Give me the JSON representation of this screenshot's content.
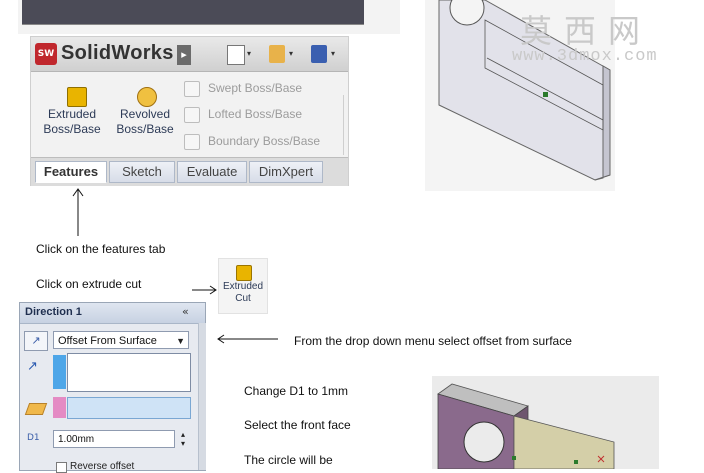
{
  "solidworks": {
    "logo_badge": "SW",
    "brand": "SolidWorks",
    "brand_arrow": "▸",
    "toolbar_caret": "▾",
    "ribbon": {
      "extruded_boss": "Extruded Boss/Base",
      "revolved_boss": "Revolved Boss/Base",
      "swept_boss": "Swept Boss/Base",
      "lofted_boss": "Lofted Boss/Base",
      "boundary_boss": "Boundary Boss/Base"
    },
    "tabs": [
      "Features",
      "Sketch",
      "Evaluate",
      "DimXpert"
    ],
    "active_tab": "Features"
  },
  "watermark": {
    "main": "莫西网",
    "url": "www.3dmox.com"
  },
  "instructions": {
    "features_tab": "Click on the features tab",
    "extrude_cut": "Click on extrude cut",
    "dropdown": "From the drop down menu  select offset from surface",
    "change_d1": "Change D1 to 1mm",
    "select_face": "Select the front face",
    "circle": "The circle will be"
  },
  "extruded_cut": {
    "label": "Extruded Cut"
  },
  "direction_panel": {
    "title": "Direction 1",
    "collapse_glyph": "«",
    "type_button_glyph": "↗",
    "end_condition": "Offset From Surface",
    "select_caret": "▼",
    "direction_arrow_glyph": "↗",
    "d1_glyph": "D1",
    "d1_value": "1.00mm",
    "spin_up": "▴",
    "spin_down": "▾",
    "reverse_offset": "Reverse offset"
  },
  "colors": {
    "ribbon_tab_border": "#aeb8c8",
    "panel_bg": "#e7eaf0",
    "blue_swatch": "#4ea6e8",
    "pink_swatch": "#e48bc4",
    "model_top_face": "#e2e2ea",
    "model_purple_face": "#8a6a8c"
  }
}
